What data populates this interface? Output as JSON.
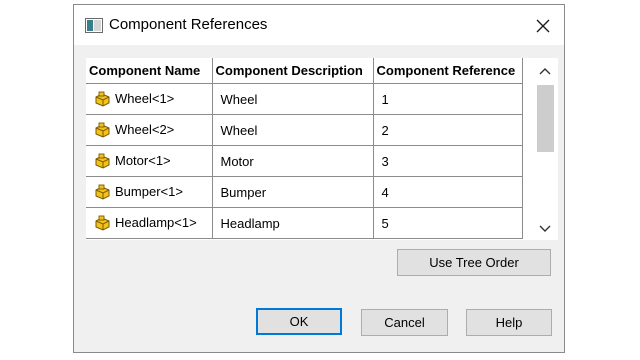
{
  "dialog": {
    "title": "Component References",
    "close_icon": "close-icon",
    "app_icon": "window-icon"
  },
  "grid": {
    "columns": [
      "Component Name",
      "Component Description",
      "Component Reference"
    ],
    "rows": [
      {
        "name": "Wheel<1>",
        "description": "Wheel",
        "reference": "1",
        "icon": "part-icon"
      },
      {
        "name": "Wheel<2>",
        "description": "Wheel",
        "reference": "2",
        "icon": "part-icon"
      },
      {
        "name": "Motor<1>",
        "description": "Motor",
        "reference": "3",
        "icon": "part-icon"
      },
      {
        "name": "Bumper<1>",
        "description": "Bumper",
        "reference": "4",
        "icon": "part-icon"
      },
      {
        "name": "Headlamp<1>",
        "description": "Headlamp",
        "reference": "5",
        "icon": "part-icon"
      }
    ]
  },
  "buttons": {
    "tree_order": "Use Tree Order",
    "ok": "OK",
    "cancel": "Cancel",
    "help": "Help"
  },
  "colors": {
    "default_button_border": "#0078d7",
    "part_icon_fill": "#f2c21b"
  }
}
